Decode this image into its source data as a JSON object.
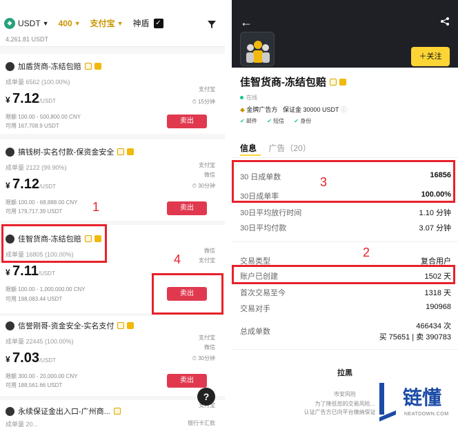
{
  "left": {
    "topbar": {
      "currency": "USDT",
      "amount": "400",
      "payment": "支付宝",
      "shendun": "神盾",
      "top_cut_text": "4,261.81 USDT"
    },
    "cards": [
      {
        "name": "加盾货商-冻结包赔",
        "stat": "成单量 6562 (100.00%)",
        "price": "7.12",
        "unit": "/USDT",
        "limit": "限额 100.00 - 500,800.00 CNY",
        "avail": "可用 167,708.9 USDT",
        "pay1": "支付宝",
        "pay2": "15分钟",
        "btn": "卖出"
      },
      {
        "name": "搞钱树-实名付款-保资金安全",
        "stat": "成单量 2122 (99.90%)",
        "price": "7.12",
        "unit": "/USDT",
        "limit": "限额 100.00 - 68,888.00 CNY",
        "avail": "可用 179,717.39 USDT",
        "pay1": "支付宝",
        "pay2": "微信",
        "pay3": "30分钟",
        "btn": "卖出"
      },
      {
        "name": "佳智货商-冻结包赔",
        "stat": "成单量 16805 (100.00%)",
        "price": "7.11",
        "unit": "/USDT",
        "limit": "限额 100.00 - 1,000,000.00 CNY",
        "avail": "可用 198,083.44 USDT",
        "pay1": "微信",
        "pay2": "支付宝",
        "btn": "卖出"
      },
      {
        "name": "信誉刚哥-资金安全-实名支付",
        "stat": "成单量 22445 (100.00%)",
        "price": "7.03",
        "unit": "/USDT",
        "limit": "限额 300.00 - 20,000.00 CNY",
        "avail": "可用 188,561.66 USDT",
        "pay1": "支付宝",
        "pay2": "微信",
        "pay3": "30分钟",
        "btn": "卖出"
      },
      {
        "name": "永续保证金出入口-广州商...",
        "stat": "成单量 20...",
        "pay1": "支付宝",
        "pay2": "银行卡汇款"
      }
    ],
    "help": "?"
  },
  "right": {
    "follow": "关注",
    "name": "佳智货商-冻结包赔",
    "online": "在线",
    "deposit_label": "金牌广告方",
    "deposit": "保证金 30000 USDT",
    "verify": [
      "邮件",
      "短信",
      "身份"
    ],
    "tab_info": "信息",
    "tab_ads": "广告（20）",
    "rows": [
      {
        "label": "30 日成单数",
        "value": "16856"
      },
      {
        "label": "30日成单率",
        "value": "100.00%"
      },
      {
        "label": "30日平均放行时间",
        "value": "1.10 分钟"
      },
      {
        "label": "30日平均付款",
        "value": "3.07 分钟"
      },
      {
        "label": "交易类型",
        "value": "复合用户"
      },
      {
        "label": "账户已创建",
        "value": "1502 天"
      },
      {
        "label": "首次交易至今",
        "value": "1318 天"
      },
      {
        "label": "交易对手",
        "value": "190968"
      },
      {
        "label": "总成单数",
        "value": "466434 次"
      }
    ],
    "total_detail": "买 75651 | 卖 390783",
    "block": "拉黑",
    "block_sub1": "市安风险",
    "block_sub2": "为了降低您的交易风险...",
    "block_sub3": "认证广告方已向平台缴纳保证金..."
  },
  "annotations": [
    "1",
    "2",
    "3",
    "4"
  ],
  "logo": {
    "text": "链懂",
    "sub": "NEATDOWN.COM"
  },
  "colors": {
    "sell": "#e0394f",
    "gold": "#fcd535",
    "annot": "#e8202a",
    "header": "#1e2026"
  }
}
